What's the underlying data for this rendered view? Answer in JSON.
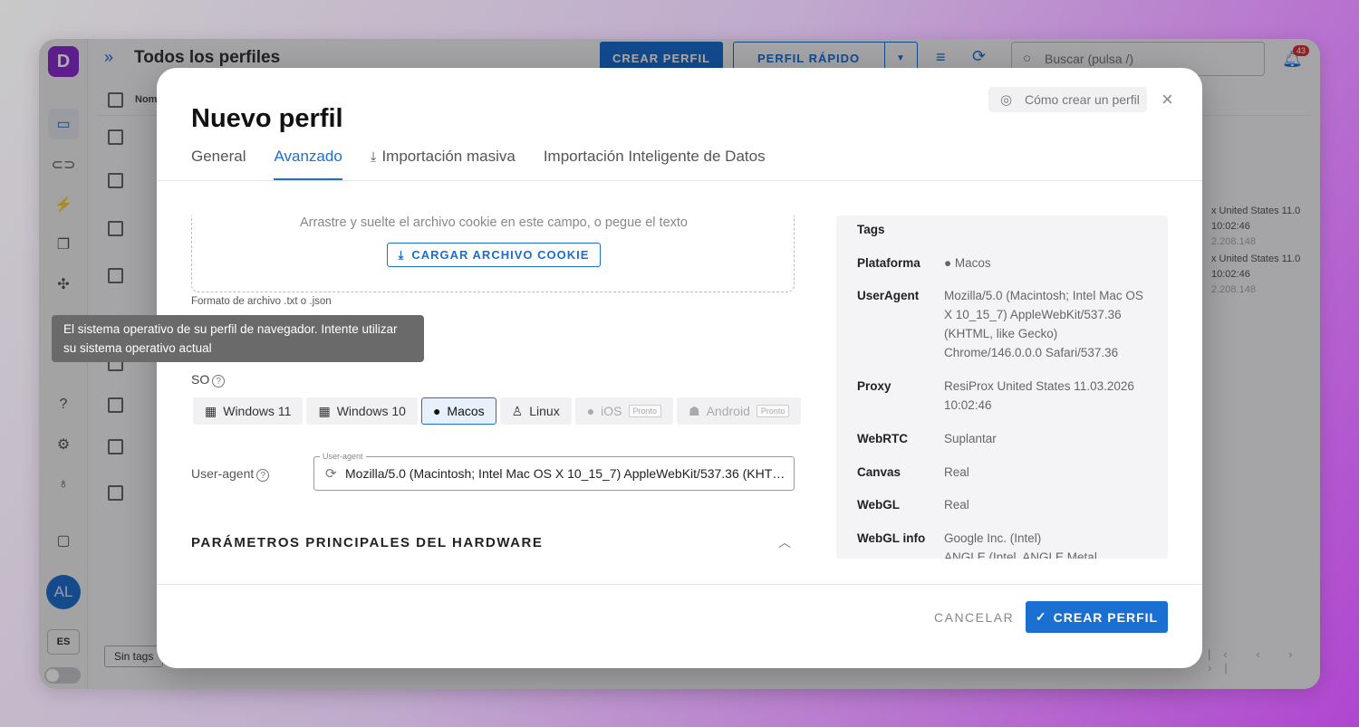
{
  "app": {
    "logo_letter": "D",
    "title": "Todos los perfiles",
    "crear_perfil_label": "CREAR PERFIL",
    "perfil_rapido_label": "PERFIL RÁPIDO",
    "search_placeholder": "Buscar (pulsa /)",
    "notifications_count": "43",
    "column_name": "Nom",
    "avatar_initials": "AL",
    "language": "ES",
    "tags_filter": "Sin tags",
    "bg_rows": [
      {
        "line1": "x United States 11.0",
        "line2": "10:02:46",
        "line3": "2.208.148"
      },
      {
        "line1": "x United States 11.0",
        "line2": "10:02:46",
        "line3": "2.208.148"
      }
    ]
  },
  "dialog": {
    "title": "Nuevo perfil",
    "help_label": "Cómo crear un perfil",
    "tabs": [
      {
        "label": "General"
      },
      {
        "label": "Avanzado"
      },
      {
        "label": "Importación masiva"
      },
      {
        "label": "Importación Inteligente de Datos"
      }
    ],
    "dropzone_text": "Arrastre y suelte el archivo cookie en este campo, o pegue el texto",
    "cookie_button": "CARGAR ARCHIVO COOKIE",
    "file_format": "Formato de archivo .txt o .json",
    "tooltip": "El sistema operativo de su perfil de navegador. Intente utilizar su sistema operativo actual",
    "os_label": "SO",
    "os_options": [
      {
        "label": "Windows 11"
      },
      {
        "label": "Windows 10"
      },
      {
        "label": "Macos"
      },
      {
        "label": "Linux"
      },
      {
        "label": "iOS",
        "badge": "Pronto"
      },
      {
        "label": "Android",
        "badge": "Pronto"
      }
    ],
    "ua_label": "User-agent",
    "ua_float": "User-agent",
    "ua_value": "Mozilla/5.0 (Macintosh; Intel Mac OS X 10_15_7) AppleWebKit/537.36 (KHTML,...",
    "hw_title": "PARÁMETROS PRINCIPALES DEL HARDWARE",
    "summary": {
      "tags_key": "Tags",
      "platform_key": "Plataforma",
      "platform_val": "Macos",
      "ua_key": "UserAgent",
      "ua_val": "Mozilla/5.0 (Macintosh; Intel Mac OS X 10_15_7) AppleWebKit/537.36 (KHTML, like Gecko) Chrome/146.0.0.0 Safari/537.36",
      "proxy_key": "Proxy",
      "proxy_val": "ResiProx United States 11.03.2026 10:02:46",
      "webrtc_key": "WebRTC",
      "webrtc_val": "Suplantar",
      "canvas_key": "Canvas",
      "canvas_val": "Real",
      "webgl_key": "WebGL",
      "webgl_val": "Real",
      "webglinfo_key": "WebGL info",
      "webglinfo_val": "Google Inc. (Intel)",
      "webglinfo_val2": "ANGLE (Intel, ANGLE Metal"
    },
    "cancel_label": "CANCELAR",
    "create_label": "CREAR PERFIL"
  },
  "colors": {
    "accent": "#1a6fd1",
    "brand": "#8b2bd0"
  }
}
